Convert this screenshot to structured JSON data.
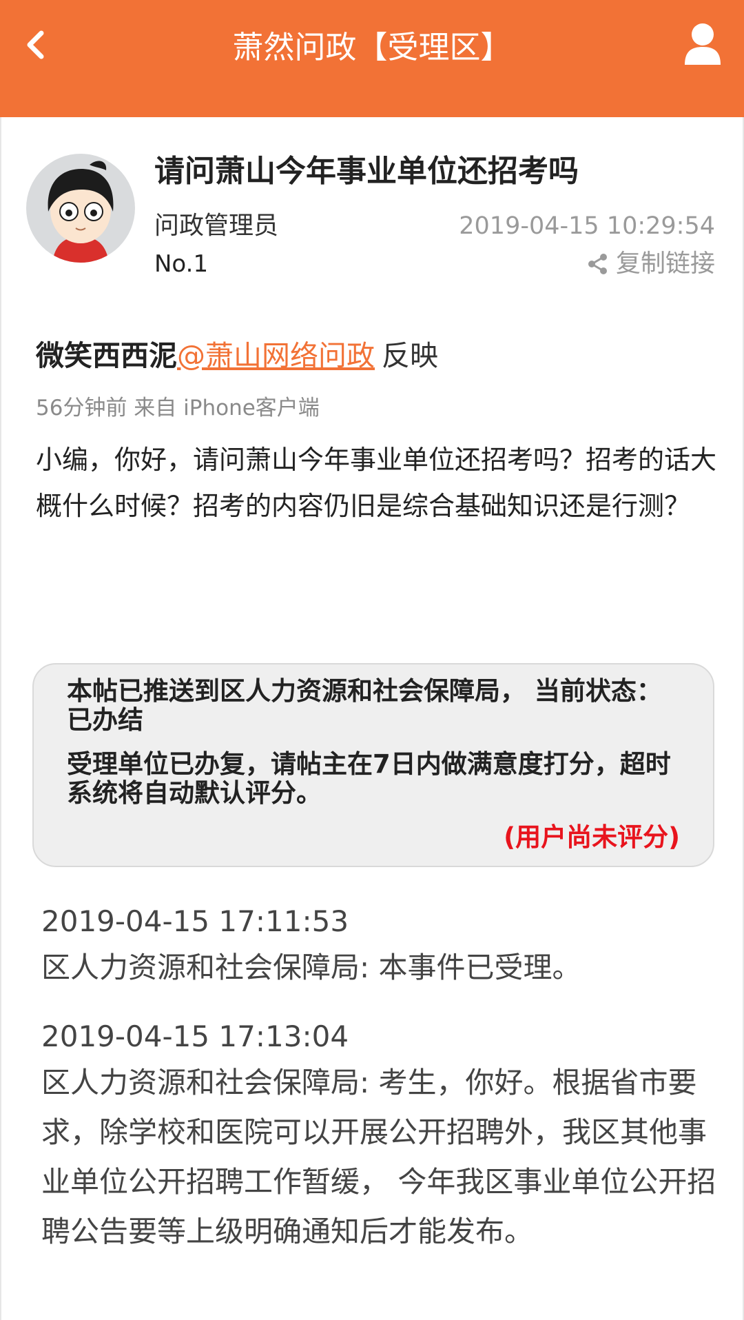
{
  "header": {
    "title": "萧然问政【受理区】"
  },
  "post": {
    "title": "请问萧山今年事业单位还招考吗",
    "author": "问政管理员",
    "rank": "No.1",
    "datetime": "2019-04-15 10:29:54",
    "copy_link_label": "复制链接",
    "reporter_name": "微笑西西泥",
    "mention": "@萧山网络问政",
    "verb": "反映",
    "meta": "56分钟前 来自 iPhone客户端",
    "body": "小编，你好，请问萧山今年事业单位还招考吗？招考的话大概什么时候？招考的内容仍旧是综合基础知识还是行测？"
  },
  "status": {
    "status_text": "本帖已推送到区人力资源和社会保障局， 当前状态： 已办结",
    "notice_text": "受理单位已办复，请帖主在7日内做满意度打分，超时系统将自动默认评分。",
    "rating_status": "(用户尚未评分)"
  },
  "replies": [
    {
      "time": "2019-04-15 17:11:53",
      "text": "区人力资源和社会保障局: 本事件已受理。"
    },
    {
      "time": "2019-04-15 17:13:04",
      "text": "区人力资源和社会保障局: 考生，你好。根据省市要求，除学校和医院可以开展公开招聘外，我区其他事业单位公开招聘工作暂缓， 今年我区事业单位公开招聘公告要等上级明确通知后才能发布。"
    }
  ],
  "colors": {
    "accent": "#f27236",
    "rating_status": "#e8141d",
    "status_box_bg": "#efefef"
  },
  "icons": {
    "back": "chevron-left-icon",
    "user": "user-icon",
    "share": "share-icon"
  }
}
